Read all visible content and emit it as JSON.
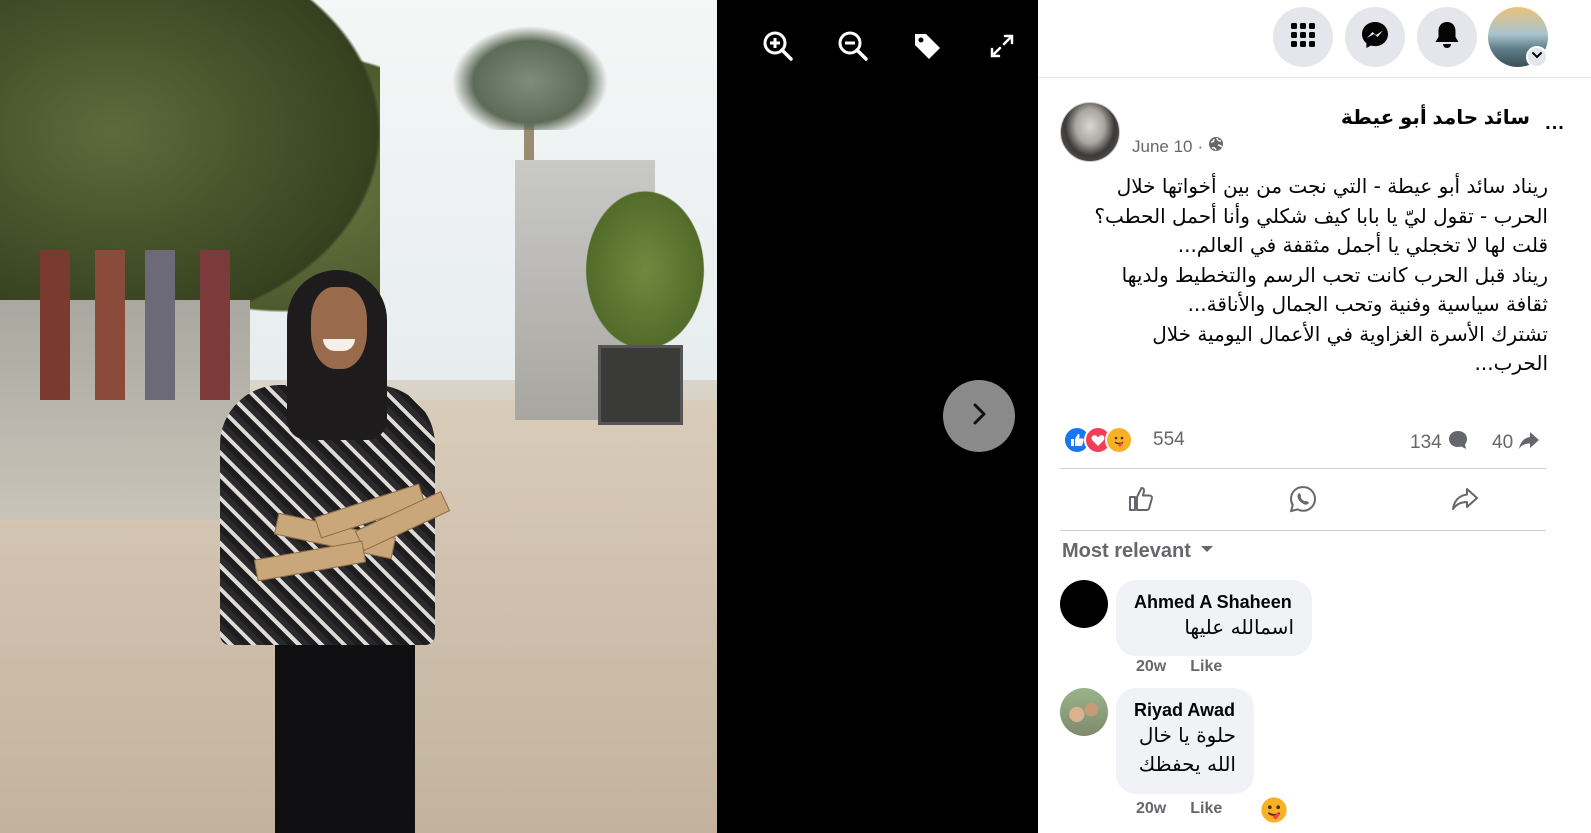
{
  "viewer": {
    "tools": [
      "zoom-in-icon",
      "zoom-out-icon",
      "tag-icon",
      "fullscreen-icon"
    ],
    "next_icon": "chevron-right-icon"
  },
  "topbar": {
    "buttons": [
      "menu-grid-icon",
      "messenger-icon",
      "notifications-bell-icon"
    ],
    "profile_caret_icon": "chevron-down-icon"
  },
  "post": {
    "author": "سائد حامد أبو عيطة",
    "date": "June 10",
    "dot": "·",
    "privacy_icon": "globe-icon",
    "more_label": "...",
    "lines": [
      "ريناد سائد أبو عيطة - التي نجت من بين أخواتها خلال",
      "الحرب - تقول ليّ يا بابا كيف شكلي وأنا أحمل الحطب؟",
      "قلت لها لا تخجلي يا أجمل مثقفة في العالم...",
      "ريناد قبل الحرب كانت تحب الرسم والتخطيط ولديها",
      "ثقافة سياسية وفنية وتحب الجمال والأناقة...",
      "تشترك الأسرة الغزاوية في الأعمال اليومية خلال",
      "الحرب..."
    ],
    "reactions": {
      "icons": [
        "like-reaction-icon",
        "love-reaction-icon",
        "care-reaction-icon"
      ],
      "count": "554",
      "comments": "134",
      "shares": "40"
    },
    "actions": [
      "like-icon",
      "whatsapp-icon",
      "share-icon"
    ]
  },
  "comments": {
    "sort_label": "Most relevant",
    "items": [
      {
        "name": "Ahmed A Shaheen",
        "text_lines": [
          "اسمالله عليها"
        ],
        "time": "20w",
        "like": "Like"
      },
      {
        "name": "Riyad Awad",
        "text_lines": [
          "حلوة يا خال",
          "الله يحفظك"
        ],
        "time": "20w",
        "like": "Like"
      }
    ]
  },
  "colors": {
    "accent_blue": "#1877f2",
    "love_red": "#f33e58",
    "care_yellow": "#f7b125",
    "secondary_text": "#65676b",
    "bubble_bg": "#f0f2f5"
  }
}
